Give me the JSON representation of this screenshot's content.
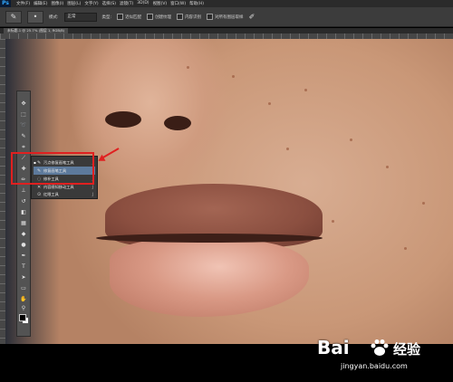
{
  "app": {
    "logo": "Ps"
  },
  "menu": [
    "文件(F)",
    "编辑(E)",
    "图像(I)",
    "图层(L)",
    "文字(Y)",
    "选择(S)",
    "滤镜(T)",
    "3D(D)",
    "视图(V)",
    "窗口(W)",
    "帮助(H)"
  ],
  "options": {
    "tool_icon": "brush-icon",
    "mode_label": "模式:",
    "mode_value": "正常",
    "type_label": "类型:",
    "type_option": "近似匹配",
    "option2": "创建纹理",
    "option3": "内容识别",
    "sample_all": "对所有图层取样"
  },
  "document": {
    "tab_label": "未标题-1 @ 25.7% (图层 1, RGB/8)"
  },
  "toolbox": {
    "tools": [
      "move",
      "marquee",
      "lasso",
      "quick-select",
      "crop",
      "eyedropper",
      "spot-healing",
      "brush",
      "clone-stamp",
      "history-brush",
      "eraser",
      "gradient",
      "blur",
      "dodge",
      "pen",
      "type",
      "path-select",
      "shape",
      "hand",
      "zoom"
    ]
  },
  "flyout": {
    "items": [
      {
        "label": "污点修复画笔工具",
        "key": "J",
        "selected": false,
        "current": true
      },
      {
        "label": "修复画笔工具",
        "key": "J",
        "selected": true,
        "current": false
      },
      {
        "label": "修补工具",
        "key": "J",
        "selected": false,
        "current": false
      },
      {
        "label": "内容感知移动工具",
        "key": "J",
        "selected": false,
        "current": false
      },
      {
        "label": "红眼工具",
        "key": "J",
        "selected": false,
        "current": false
      }
    ]
  },
  "watermark": {
    "brand": "Bai",
    "brand2": "经验",
    "url": "jingyan.baidu.com"
  },
  "colors": {
    "highlight": "#e02020",
    "selection": "#5d7a9c"
  }
}
